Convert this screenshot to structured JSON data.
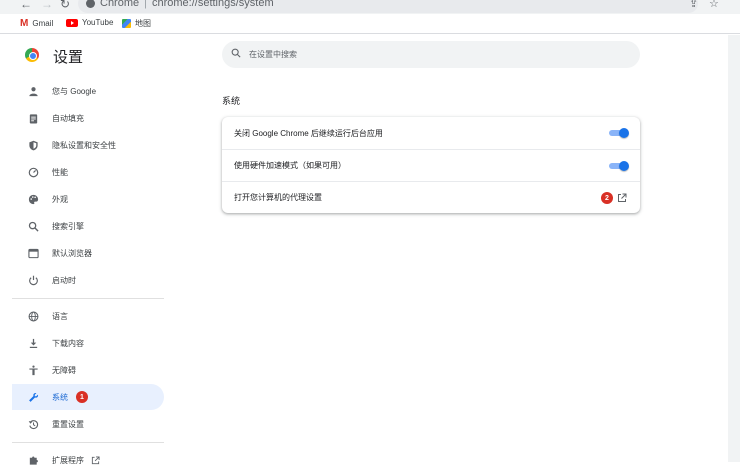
{
  "browser": {
    "omnibox_site": "Chrome",
    "omnibox_url": "chrome://settings/system",
    "bookmarks": [
      {
        "label": "Gmail",
        "icon": "gmail-icon"
      },
      {
        "label": "YouTube",
        "icon": "youtube-icon"
      },
      {
        "label": "地图",
        "icon": "maps-icon"
      }
    ]
  },
  "settings": {
    "title": "设置",
    "search_placeholder": "在设置中搜索"
  },
  "sidebar": {
    "items": [
      {
        "label": "您与 Google",
        "icon": "person-icon"
      },
      {
        "label": "自动填充",
        "icon": "clipboard-icon"
      },
      {
        "label": "隐私设置和安全性",
        "icon": "shield-icon"
      },
      {
        "label": "性能",
        "icon": "speedometer-icon"
      },
      {
        "label": "外观",
        "icon": "palette-icon"
      },
      {
        "label": "搜索引擎",
        "icon": "search-icon"
      },
      {
        "label": "默认浏览器",
        "icon": "browser-icon"
      },
      {
        "label": "启动时",
        "icon": "power-icon"
      },
      {
        "label": "语言",
        "icon": "globe-icon"
      },
      {
        "label": "下载内容",
        "icon": "download-icon"
      },
      {
        "label": "无障碍",
        "icon": "accessibility-icon"
      },
      {
        "label": "系统",
        "icon": "wrench-icon",
        "active": true,
        "badge": "1"
      },
      {
        "label": "重置设置",
        "icon": "reset-icon"
      },
      {
        "label": "扩展程序",
        "icon": "puzzle-icon"
      }
    ]
  },
  "main": {
    "section_title": "系统",
    "rows": [
      {
        "label": "关闭 Google Chrome 后继续运行后台应用",
        "toggle": true
      },
      {
        "label": "使用硬件加速模式（如果可用）",
        "toggle": true
      },
      {
        "label": "打开您计算机的代理设置",
        "badge": "2",
        "icon": "open-in-new-icon"
      }
    ]
  },
  "colors": {
    "accent": "#1a73e8",
    "active_bg": "#e8f0fe",
    "badge": "#d93025"
  }
}
